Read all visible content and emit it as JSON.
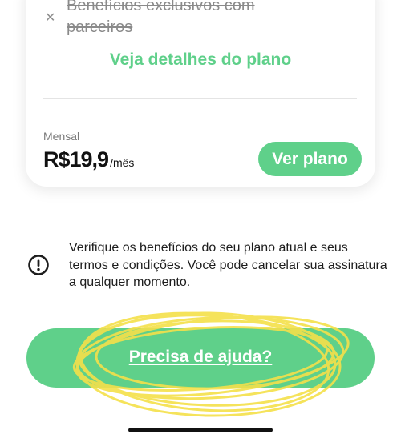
{
  "plan_card": {
    "benefit_text": "Benefícios exclusivos com parceiros",
    "details_link": "Veja detalhes do plano",
    "period": "Mensal",
    "price": "R$19,9",
    "price_unit": "/mês",
    "view_plan_button": "Ver plano"
  },
  "info": {
    "text": "Verifique os benefícios do seu plano atual e seus termos e condições. Você pode cancelar sua assinatura a qualquer momento."
  },
  "help": {
    "button_label": "Precisa de ajuda?"
  },
  "colors": {
    "accent_green": "#5fd08a",
    "highlight_yellow": "#f5e04a"
  },
  "icons": {
    "x": "close-icon",
    "info": "info-circle-icon"
  }
}
